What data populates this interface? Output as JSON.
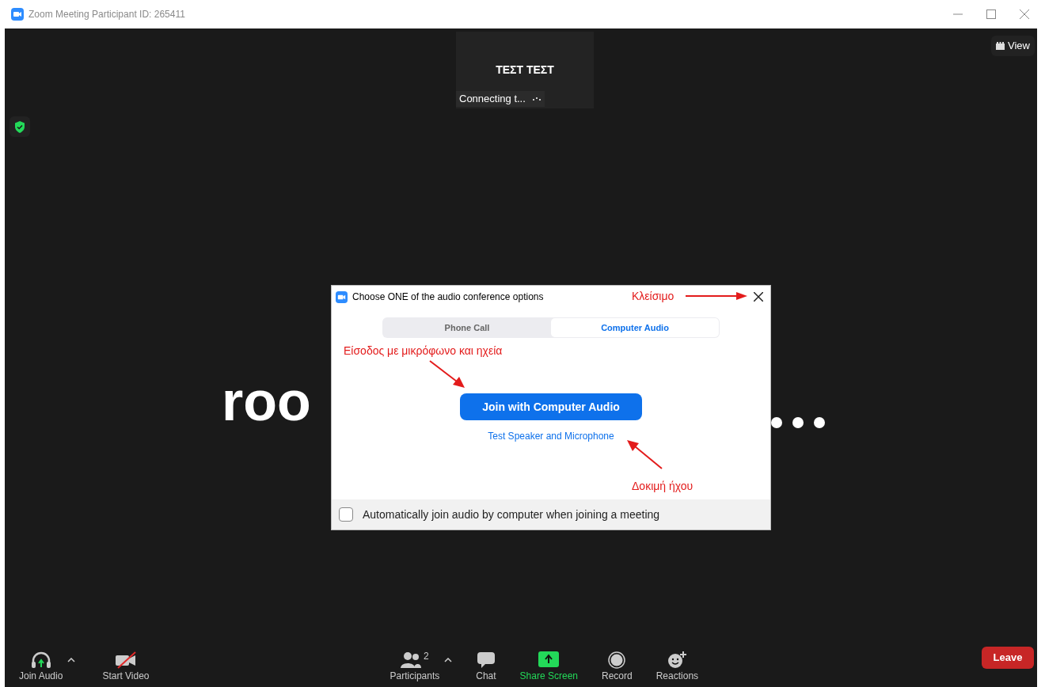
{
  "window": {
    "title": "Zoom Meeting Participant ID: 265411"
  },
  "view_button": {
    "label": "View"
  },
  "participant_tile": {
    "name": "ΤΕΣΤ ΤΕΣΤ",
    "status": "Connecting t..."
  },
  "background_text": "roo",
  "dialog": {
    "title": "Choose ONE of the audio conference options",
    "tabs": [
      {
        "label": "Phone Call",
        "selected": false
      },
      {
        "label": "Computer Audio",
        "selected": true
      }
    ],
    "join_button": "Join with Computer Audio",
    "test_link": "Test Speaker and Microphone",
    "auto_join": {
      "label": "Automatically join audio by computer when joining a meeting",
      "checked": false
    }
  },
  "annotations": [
    {
      "kind": "close",
      "text": "Κλείσιμο"
    },
    {
      "kind": "join",
      "text": "Είσοδος με μικρόφωνο και ηχεία"
    },
    {
      "kind": "test",
      "text": "Δοκιμή ήχου"
    }
  ],
  "toolbar": {
    "items": [
      {
        "kind": "audio",
        "label": "Join Audio",
        "caret": true
      },
      {
        "kind": "video",
        "label": "Start Video",
        "caret": false
      },
      {
        "kind": "participants",
        "label": "Participants",
        "count": "2",
        "caret": true
      },
      {
        "kind": "chat",
        "label": "Chat",
        "caret": false
      },
      {
        "kind": "share",
        "label": "Share Screen",
        "caret": false
      },
      {
        "kind": "record",
        "label": "Record",
        "caret": false
      },
      {
        "kind": "reactions",
        "label": "Reactions",
        "caret": false
      }
    ],
    "leave": "Leave"
  }
}
